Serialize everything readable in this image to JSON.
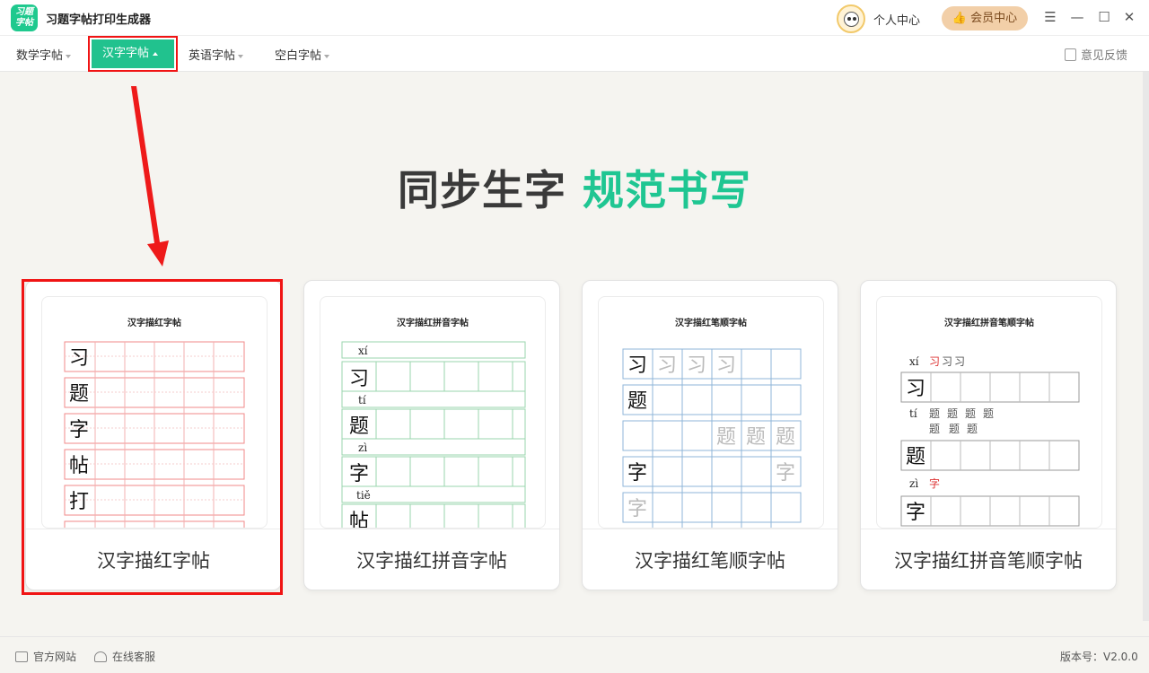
{
  "app": {
    "logo_text": "习题\n字帖",
    "title": "习题字帖打印生成器",
    "user_center": "个人中心",
    "vip": "会员中心",
    "menu_icon": "menu-icon",
    "minimize_icon": "minimize-icon",
    "maximize_icon": "maximize-icon",
    "close_icon": "close-icon"
  },
  "menu": {
    "items": [
      {
        "label": "数学字帖",
        "active": false
      },
      {
        "label": "汉字字帖",
        "active": true
      },
      {
        "label": "英语字帖",
        "active": false
      },
      {
        "label": "空白字帖",
        "active": false
      }
    ],
    "feedback": "意见反馈"
  },
  "main": {
    "headline_part1": "同步生字",
    "headline_part2": "规范书写"
  },
  "cards": [
    {
      "preview_title": "汉字描红字帖",
      "label": "汉字描红字帖",
      "chars": [
        "习",
        "题",
        "字",
        "帖",
        "打"
      ],
      "selected": true
    },
    {
      "preview_title": "汉字描红拼音字帖",
      "label": "汉字描红拼音字帖",
      "pinyin": [
        "xí",
        "tí",
        "zì",
        "tiě"
      ],
      "chars": [
        "习",
        "题",
        "字",
        "帖"
      ],
      "selected": false
    },
    {
      "preview_title": "汉字描红笔顺字帖",
      "label": "汉字描红笔顺字帖",
      "chars": [
        "习",
        "题",
        "字"
      ],
      "selected": false
    },
    {
      "preview_title": "汉字描红拼音笔顺字帖",
      "label": "汉字描红拼音笔顺字帖",
      "pinyin": [
        "xí",
        "tí",
        "zì"
      ],
      "chars": [
        "习",
        "题",
        "字"
      ],
      "selected": false
    }
  ],
  "status": {
    "official_site": "官方网站",
    "online_service": "在线客服",
    "version": "版本号：V2.0.0"
  },
  "colors": {
    "accent": "#21c28e",
    "highlight_red": "#f01414",
    "vip_bg": "#f2cfa8",
    "grid_red": "#f08a8a",
    "grid_green": "#7fcf9a",
    "grid_blue": "#8fb6d8"
  }
}
